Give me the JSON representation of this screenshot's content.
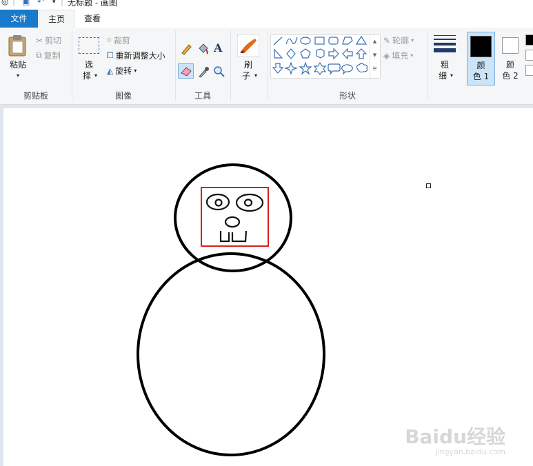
{
  "window": {
    "title": "无标题 - 画图"
  },
  "tabs": [
    {
      "label": "文件"
    },
    {
      "label": "主页"
    },
    {
      "label": "查看"
    }
  ],
  "ribbon": {
    "clipboard": {
      "group_label": "剪贴板",
      "paste": "粘贴",
      "cut": "剪切",
      "copy": "复制"
    },
    "image": {
      "group_label": "图像",
      "select_line1": "选",
      "select_line2": "择",
      "crop": "裁剪",
      "resize": "重新调整大小",
      "rotate": "旋转"
    },
    "tools": {
      "group_label": "工具"
    },
    "brushes": {
      "line1": "刷",
      "line2": "子"
    },
    "shapes": {
      "group_label": "形状",
      "outline": "轮廓",
      "fill": "填充"
    },
    "size": {
      "line1": "粗",
      "line2": "细"
    },
    "color1": {
      "line1": "颜",
      "line2": "色 1",
      "value": "#000000"
    },
    "color2": {
      "line1": "颜",
      "line2": "色 2",
      "value": "#ffffff"
    }
  },
  "colors": {
    "file_tab": "#1979ca",
    "selected_tool": "#cce4f7",
    "face_frame": "#d9201c"
  },
  "watermark": {
    "brand": "Baidu经验",
    "url": "jingyan.baidu.com"
  }
}
